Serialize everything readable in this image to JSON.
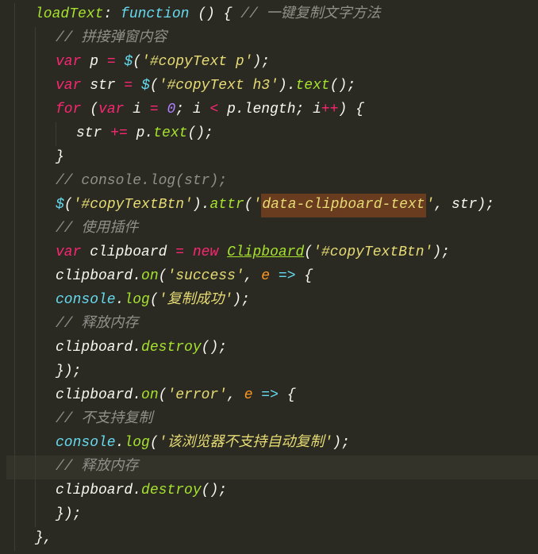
{
  "code": {
    "l1_name": "loadText",
    "l1_fn": "function",
    "l1_paren": " () {",
    "l1_cmt": " // 一键复制文字方法",
    "l2_cmt": "// 拼接弹窗内容",
    "l3_var": "var",
    "l3_id": " p ",
    "l3_eq": "=",
    "l3_dollar": " $",
    "l3_paren1": "(",
    "l3_str": "'#copyText p'",
    "l3_paren2": ");",
    "l4_var": "var",
    "l4_id": " str ",
    "l4_eq": "=",
    "l4_dollar": " $",
    "l4_p1": "(",
    "l4_str": "'#copyText h3'",
    "l4_p2": ").",
    "l4_fn": "text",
    "l4_p3": "();",
    "l5_for": "for",
    "l5_p1": " (",
    "l5_var": "var",
    "l5_i": " i ",
    "l5_eq": "=",
    "l5_zero": " 0",
    "l5_semi1": "; i ",
    "l5_lt": "<",
    "l5_plen": " p.length; i",
    "l5_inc": "++",
    "l5_p2": ") {",
    "l6_a": "str ",
    "l6_op": "+=",
    "l6_b": " p.",
    "l6_fn": "text",
    "l6_c": "();",
    "l7": "}",
    "l8_cmt": "// console.log(str);",
    "l9_dollar": "$",
    "l9_p1": "(",
    "l9_str1": "'#copyTextBtn'",
    "l9_p2": ").",
    "l9_fn": "attr",
    "l9_p3": "(",
    "l9_q1": "'",
    "l9_hl": "data-clipboard-text",
    "l9_q2": "'",
    "l9_rest": ", str);",
    "l10_cmt": "// 使用插件",
    "l11_var": "var",
    "l11_id": " clipboard ",
    "l11_eq": "=",
    "l11_new": " new",
    "l11_sp": " ",
    "l11_cls": "Clipboard",
    "l11_p1": "(",
    "l11_str": "'#copyTextBtn'",
    "l11_p2": ");",
    "l12_a": "clipboard.",
    "l12_fn": "on",
    "l12_p1": "(",
    "l12_str": "'success'",
    "l12_c": ", ",
    "l12_e": "e",
    "l12_arr": " => ",
    "l12_b": "{",
    "l13_con": "console",
    "l13_dot": ".",
    "l13_log": "log",
    "l13_p1": "(",
    "l13_str": "'复制成功'",
    "l13_p2": ");",
    "l14_cmt": "// 释放内存",
    "l15_a": "clipboard.",
    "l15_fn": "destroy",
    "l15_b": "();",
    "l16": "});",
    "l17_a": "clipboard.",
    "l17_fn": "on",
    "l17_p1": "(",
    "l17_str": "'error'",
    "l17_c": ", ",
    "l17_e": "e",
    "l17_arr": " => ",
    "l17_b": "{",
    "l18_cmt": "// 不支持复制",
    "l19_con": "console",
    "l19_dot": ".",
    "l19_log": "log",
    "l19_p1": "(",
    "l19_str": "'该浏览器不支持自动复制'",
    "l19_p2": ");",
    "l20_cmt": "// 释放内存",
    "l21_a": "clipboard.",
    "l21_fn": "destroy",
    "l21_b": "();",
    "l22": "});",
    "l23": "},"
  }
}
